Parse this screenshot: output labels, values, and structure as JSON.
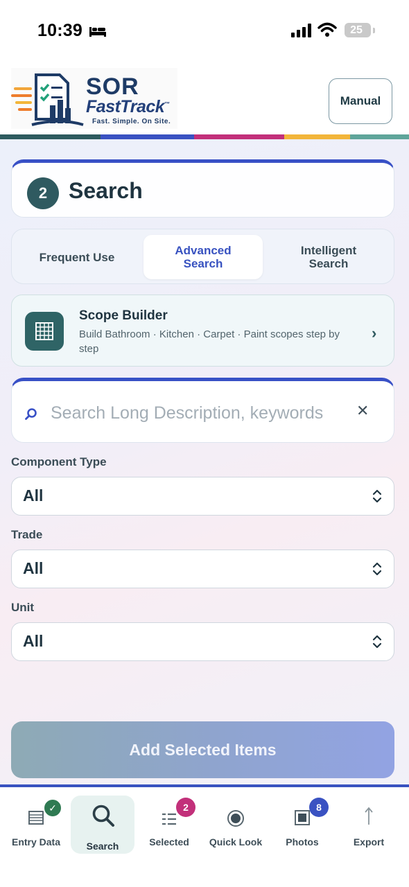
{
  "status_bar": {
    "time": "10:39",
    "battery": "25"
  },
  "header": {
    "logo": {
      "title": "SOR",
      "subtitle": "FastTrack",
      "tm": "™",
      "tagline": "Fast. Simple. On Site."
    },
    "manual_label": "Manual",
    "stripe_colors": [
      "#2e5b5f",
      "#3a52c2",
      "#c2307a",
      "#f2b53a",
      "#5fa59a"
    ]
  },
  "step": {
    "number": "2",
    "title": "Search"
  },
  "tabs": [
    {
      "label": "Frequent Use",
      "active": false
    },
    {
      "label": "Advanced Search",
      "active": true
    },
    {
      "label": "Intelligent Search",
      "active": false
    }
  ],
  "scope_builder": {
    "icon": "grid-icon",
    "title": "Scope Builder",
    "subtitle": "Build Bathroom · Kitchen · Carpet · Paint scopes step by step",
    "chevron": "›"
  },
  "search": {
    "placeholder": "Search Long Description, keywords",
    "value": "",
    "clear": "✕"
  },
  "filters": [
    {
      "label": "Component Type",
      "value": "All"
    },
    {
      "label": "Trade",
      "value": "All"
    },
    {
      "label": "Unit",
      "value": "All"
    }
  ],
  "add_button": "Add Selected Items",
  "nav": [
    {
      "label": "Entry Data",
      "icon": "list-icon",
      "badge": "✓",
      "badge_color": "#2f7a52"
    },
    {
      "label": "Search",
      "icon": "search-icon",
      "active": true
    },
    {
      "label": "Selected",
      "icon": "checklist-icon",
      "badge": "2",
      "badge_color": "#c2307a"
    },
    {
      "label": "Quick Look",
      "icon": "eye-icon"
    },
    {
      "label": "Photos",
      "icon": "photo-icon",
      "badge": "8",
      "badge_color": "#3a52c2"
    },
    {
      "label": "Export",
      "icon": "export-icon"
    }
  ],
  "colors": {
    "accent": "#3850c6",
    "teal": "#2f5a60"
  }
}
